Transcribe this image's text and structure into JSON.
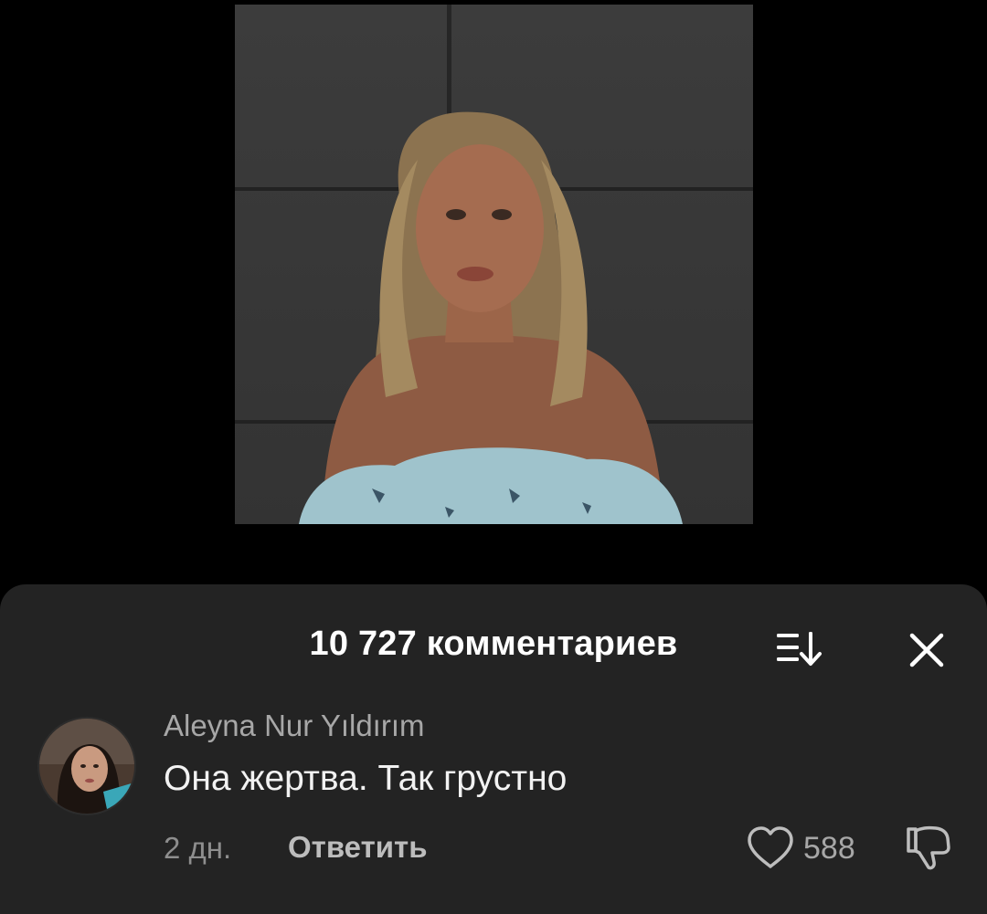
{
  "video": {
    "thumbnail_icon": "video-frame-portrait"
  },
  "comments_sheet": {
    "title": "10 727 комментариев",
    "sort_icon": "sort-icon",
    "close_icon": "close-icon"
  },
  "comment": {
    "author": "Aleyna Nur Yıldırım",
    "text": "Она жертва. Так грустно",
    "time": "2 дн.",
    "reply_label": "Ответить",
    "likes": "588",
    "like_icon": "heart-icon",
    "dislike_icon": "thumbs-down-icon"
  },
  "colors": {
    "background": "#000000",
    "sheet": "#232323",
    "primary_text": "#ffffff",
    "secondary_text": "#a7a7a7"
  }
}
